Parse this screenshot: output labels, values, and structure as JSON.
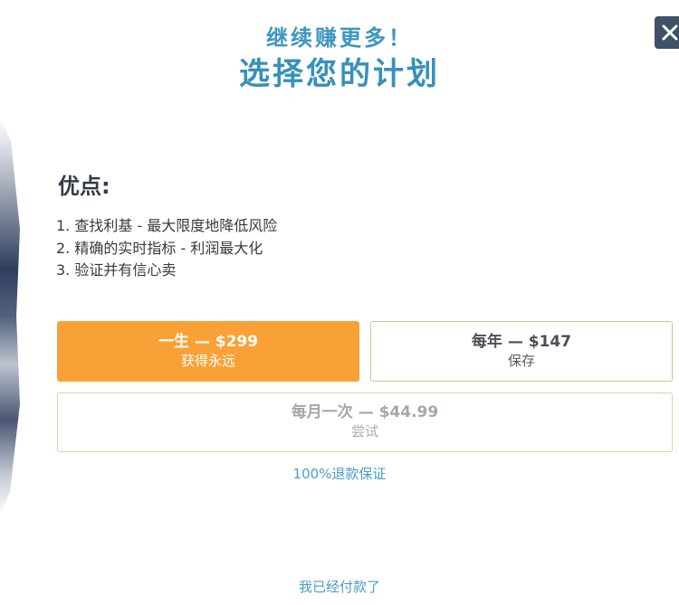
{
  "header": {
    "headline": "继续赚更多！",
    "title": "选择您的计划"
  },
  "close_icon": "close-icon",
  "benefits": {
    "heading": "优点:",
    "items": [
      "1. 查找利基 - 最大限度地降低风险",
      "2. 精确的实时指标 - 利润最大化",
      "3. 验证并有信心卖"
    ]
  },
  "plans": {
    "lifetime": {
      "name": "一生 — $299",
      "subtitle": "获得永远"
    },
    "yearly": {
      "name": "每年 — $147",
      "subtitle": "保存"
    },
    "monthly": {
      "name": "每月一次 — $44.99",
      "subtitle": "尝试"
    }
  },
  "guarantee": "100%退款保证",
  "already_paid_link": "我已经付款了",
  "colors": {
    "accent_blue": "#3791b9",
    "highlight_orange": "#f9a136",
    "plan_border_green": "#b8d28a",
    "close_button_bg": "#3f5068"
  }
}
